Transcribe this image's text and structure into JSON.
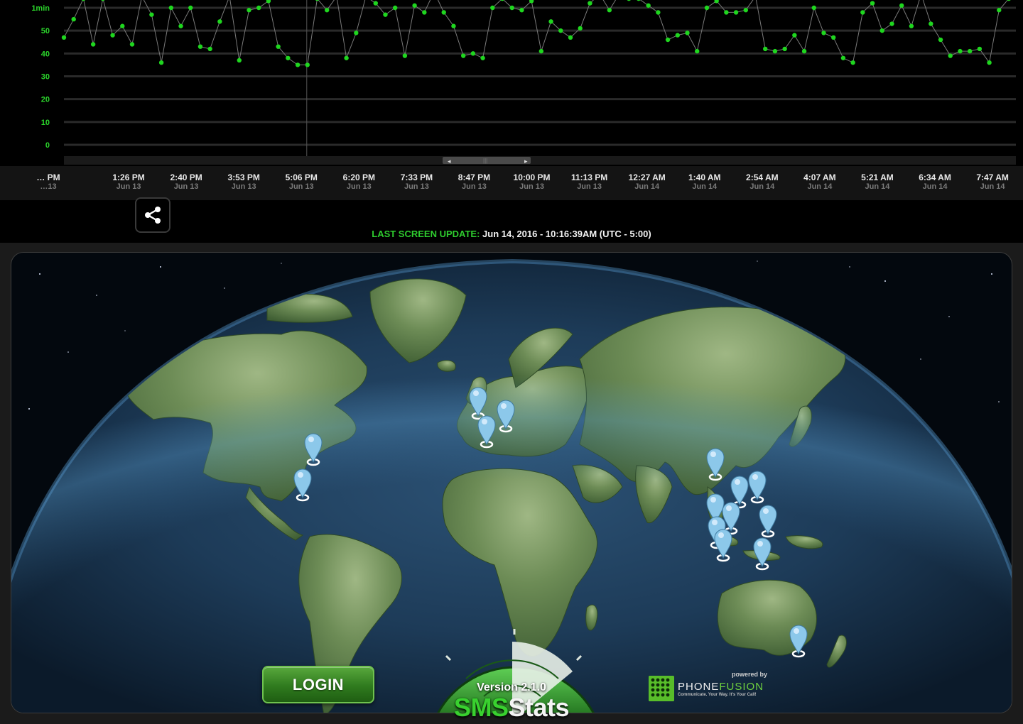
{
  "chart_data": {
    "type": "line",
    "yticks": [
      "1min",
      "50",
      "40",
      "30",
      "20",
      "10",
      "0"
    ],
    "ylim": [
      0,
      60
    ],
    "x_ticks": [
      {
        "time": "… PM",
        "date": "…13"
      },
      {
        "time": "1:26 PM",
        "date": "Jun 13"
      },
      {
        "time": "2:40 PM",
        "date": "Jun 13"
      },
      {
        "time": "3:53 PM",
        "date": "Jun 13"
      },
      {
        "time": "5:06 PM",
        "date": "Jun 13"
      },
      {
        "time": "6:20 PM",
        "date": "Jun 13"
      },
      {
        "time": "7:33 PM",
        "date": "Jun 13"
      },
      {
        "time": "8:47 PM",
        "date": "Jun 13"
      },
      {
        "time": "10:00 PM",
        "date": "Jun 13"
      },
      {
        "time": "11:13 PM",
        "date": "Jun 13"
      },
      {
        "time": "12:27 AM",
        "date": "Jun 14"
      },
      {
        "time": "1:40 AM",
        "date": "Jun 14"
      },
      {
        "time": "2:54 AM",
        "date": "Jun 14"
      },
      {
        "time": "4:07 AM",
        "date": "Jun 14"
      },
      {
        "time": "5:21 AM",
        "date": "Jun 14"
      },
      {
        "time": "6:34 AM",
        "date": "Jun 14"
      },
      {
        "time": "7:47 AM",
        "date": "Jun 14"
      }
    ],
    "series_values": [
      47,
      55,
      64,
      44,
      64,
      48,
      52,
      44,
      65,
      57,
      36,
      60,
      52,
      60,
      43,
      42,
      54,
      65,
      37,
      59,
      60,
      63,
      43,
      38,
      35,
      35,
      64,
      59,
      65,
      38,
      49,
      65,
      62,
      57,
      60,
      39,
      61,
      58,
      67,
      58,
      52,
      39,
      40,
      38,
      60,
      64,
      60,
      59,
      63,
      41,
      54,
      50,
      47,
      51,
      62,
      66,
      59,
      66,
      64,
      64,
      61,
      58,
      46,
      48,
      49,
      41,
      60,
      63,
      58,
      58,
      59,
      65,
      42,
      41,
      42,
      48,
      41,
      60,
      49,
      47,
      38,
      36,
      58,
      62,
      50,
      53,
      61,
      52,
      66,
      53,
      46,
      39,
      41,
      41,
      42,
      36,
      59,
      64
    ],
    "cursor_index": 25,
    "colors": {
      "line": "#7a7a7a",
      "marker": "#1fd61f",
      "axis_label": "#2bd42b",
      "grid": "#2a2a2a"
    }
  },
  "toolbar": {
    "share_icon": "share-icon"
  },
  "status": {
    "last_update_label": "LAST SCREEN UPDATE:",
    "last_update_value": "Jun 14, 2016 - 10:16:39AM (UTC - 5:00)"
  },
  "map": {
    "pin_icon": "map-pin-icon",
    "pins_count": 19,
    "pin_color": "#8cc8ea"
  },
  "login": {
    "label": "LOGIN"
  },
  "app": {
    "version": "Version 2.1.0",
    "logo_part1": "SMS",
    "logo_part2": "Stats"
  },
  "powered": {
    "powered_by": "powered by",
    "brand_part1": "PHONE",
    "brand_part2": "FUSION",
    "tagline": "Communicate. Your Way. It's Your Call!"
  }
}
